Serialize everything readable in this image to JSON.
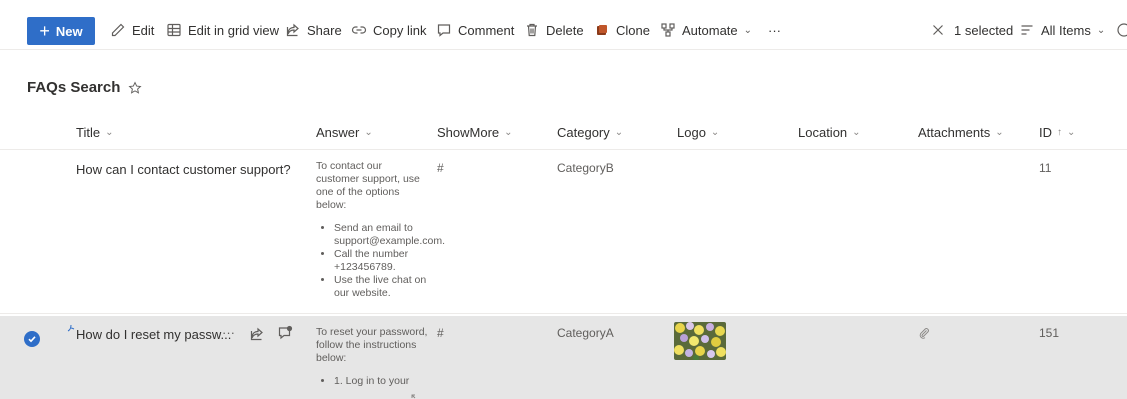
{
  "commandbar": {
    "new_label": "New",
    "edit_label": "Edit",
    "grid_label": "Edit in grid view",
    "share_label": "Share",
    "copylink_label": "Copy link",
    "comment_label": "Comment",
    "delete_label": "Delete",
    "clone_label": "Clone",
    "automate_label": "Automate",
    "more_label": "···",
    "selected_label": "1 selected",
    "view_label": "All Items"
  },
  "page": {
    "title": "FAQs Search"
  },
  "columns": {
    "title": "Title",
    "answer": "Answer",
    "showmore": "ShowMore",
    "category": "Category",
    "logo": "Logo",
    "location": "Location",
    "attachments": "Attachments",
    "id": "ID"
  },
  "rows": [
    {
      "title": "How can I contact customer support?",
      "answer_intro": "To contact our customer support, use one of the options below:",
      "answer_items": [
        "Send an email to support@example.com.",
        "Call the number +123456789.",
        "Use the live chat on our website."
      ],
      "showmore": "#",
      "category": "CategoryB",
      "id": "11"
    },
    {
      "title": "How do I reset my passw...",
      "more": "···",
      "answer_intro": "To reset your password, follow the instructions below:",
      "answer_items": [
        "1. Log in to your"
      ],
      "showmore": "#",
      "category": "CategoryA",
      "id": "151"
    }
  ],
  "icons": {
    "accent": "#2f6ec8",
    "selected_row_bg": "#e6e6e6"
  }
}
